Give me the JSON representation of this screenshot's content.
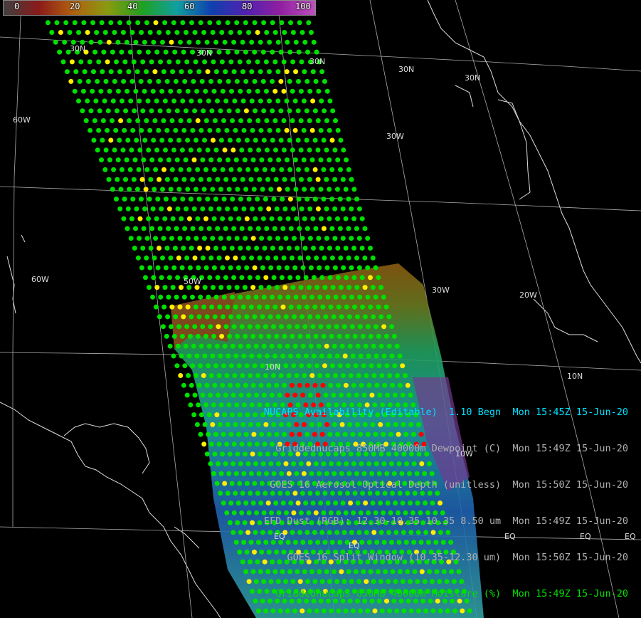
{
  "colorbar": {
    "ticks": [
      "0",
      "20",
      "40",
      "60",
      "80",
      "100"
    ],
    "colors": [
      "#404040",
      "#8a1a1a",
      "#b06010",
      "#8a9a10",
      "#20a020",
      "#10a0a0",
      "#1040b0",
      "#5020b0",
      "#9020a0",
      "#c050c0"
    ]
  },
  "grid_labels": {
    "lat_30n_a": "30N",
    "lat_30n_b": "30N",
    "lat_30n_c": "30N",
    "lat_30n_d": "30N",
    "lat_30n_e": "30N",
    "lon_60w_a": "60W",
    "lon_60w_b": "60W",
    "lon_50w": "50W",
    "lon_30w_a": "30W",
    "lon_30w_b": "30W",
    "lon_20w": "20W",
    "lat_10n_a": "10N",
    "lat_10n_b": "10N",
    "lon_10w": "10W",
    "eq_a": "EQ",
    "eq_b": "EQ",
    "eq_c": "EQ",
    "eq_d": "EQ",
    "eq_e": "EQ"
  },
  "legend": [
    {
      "label": "NUCAPS Availability (Editable)  1.10 Begn",
      "time": "Mon 15:45Z 15-Jun-20",
      "color": "#00e0ff"
    },
    {
      "label": "Griddednucaps 850MB 40000m Dewpoint (C)",
      "time": "Mon 15:49Z 15-Jun-20",
      "color": "#b0b0b0"
    },
    {
      "label": "GOES 16 Aerosol Optical Depth (unitless)",
      "time": "Mon 15:50Z 15-Jun-20",
      "color": "#b0b0b0"
    },
    {
      "label": "EFD Dust (RGB): 12.30-10.35 10.35 8.50 um",
      "time": "Mon 15:49Z 15-Jun-20",
      "color": "#b0b0b0"
    },
    {
      "label": "GOES 16 Split Window (10.35-12.30 um)",
      "time": "Mon 15:50Z 15-Jun-20",
      "color": "#b0b0b0"
    },
    {
      "label": "Griddednucaps 850MB 40000m Moisture (%)",
      "time": "Mon 15:49Z 15-Jun-20",
      "color": "#00e000"
    }
  ],
  "point_colors": {
    "good": "#00e000",
    "partial": "#ffee00",
    "failed": "#ff0000"
  }
}
